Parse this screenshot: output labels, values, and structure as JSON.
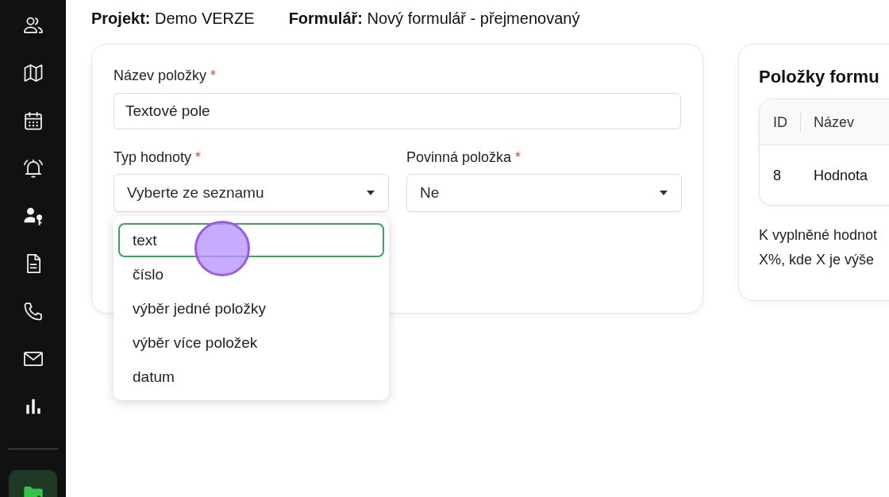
{
  "sidebar": {
    "items": [
      {
        "selected": false
      },
      {
        "selected": false
      },
      {
        "selected": false
      },
      {
        "selected": false
      },
      {
        "selected": false
      },
      {
        "selected": false
      },
      {
        "selected": false
      },
      {
        "selected": false
      },
      {
        "selected": false
      }
    ],
    "bottom_items": [
      {
        "selected": true
      }
    ]
  },
  "header": {
    "items": [
      "**Projekt:** Demo VERZE",
      "**Formulář:** Nový formulář - přejmenovaný"
    ]
  },
  "item_form": {
    "name_field": {
      "label": "Název položky",
      "required_mark": "*",
      "value": "Textové pole"
    },
    "selects": [
      {
        "label": "Typ hodnoty",
        "required_mark": "*",
        "value": "Vyberte ze seznamu",
        "options": [
          {
            "label": "text",
            "selected": true
          },
          {
            "label": "číslo",
            "selected": false
          },
          {
            "label": "výběr jedné položky",
            "selected": false
          },
          {
            "label": "výběr více položek",
            "selected": false
          },
          {
            "label": "datum",
            "selected": false
          }
        ]
      },
      {
        "label": "Povinná položka",
        "required_mark": "*",
        "value": "Ne"
      }
    ]
  },
  "form_items_panel": {
    "title": "Položky formu",
    "table": {
      "columns": [
        "ID",
        "Název"
      ],
      "rows": [
        [
          "8",
          "Hodnota"
        ]
      ]
    },
    "note_lines": [
      "K vyplněné hodnot",
      "X%, kde X je výše"
    ]
  }
}
